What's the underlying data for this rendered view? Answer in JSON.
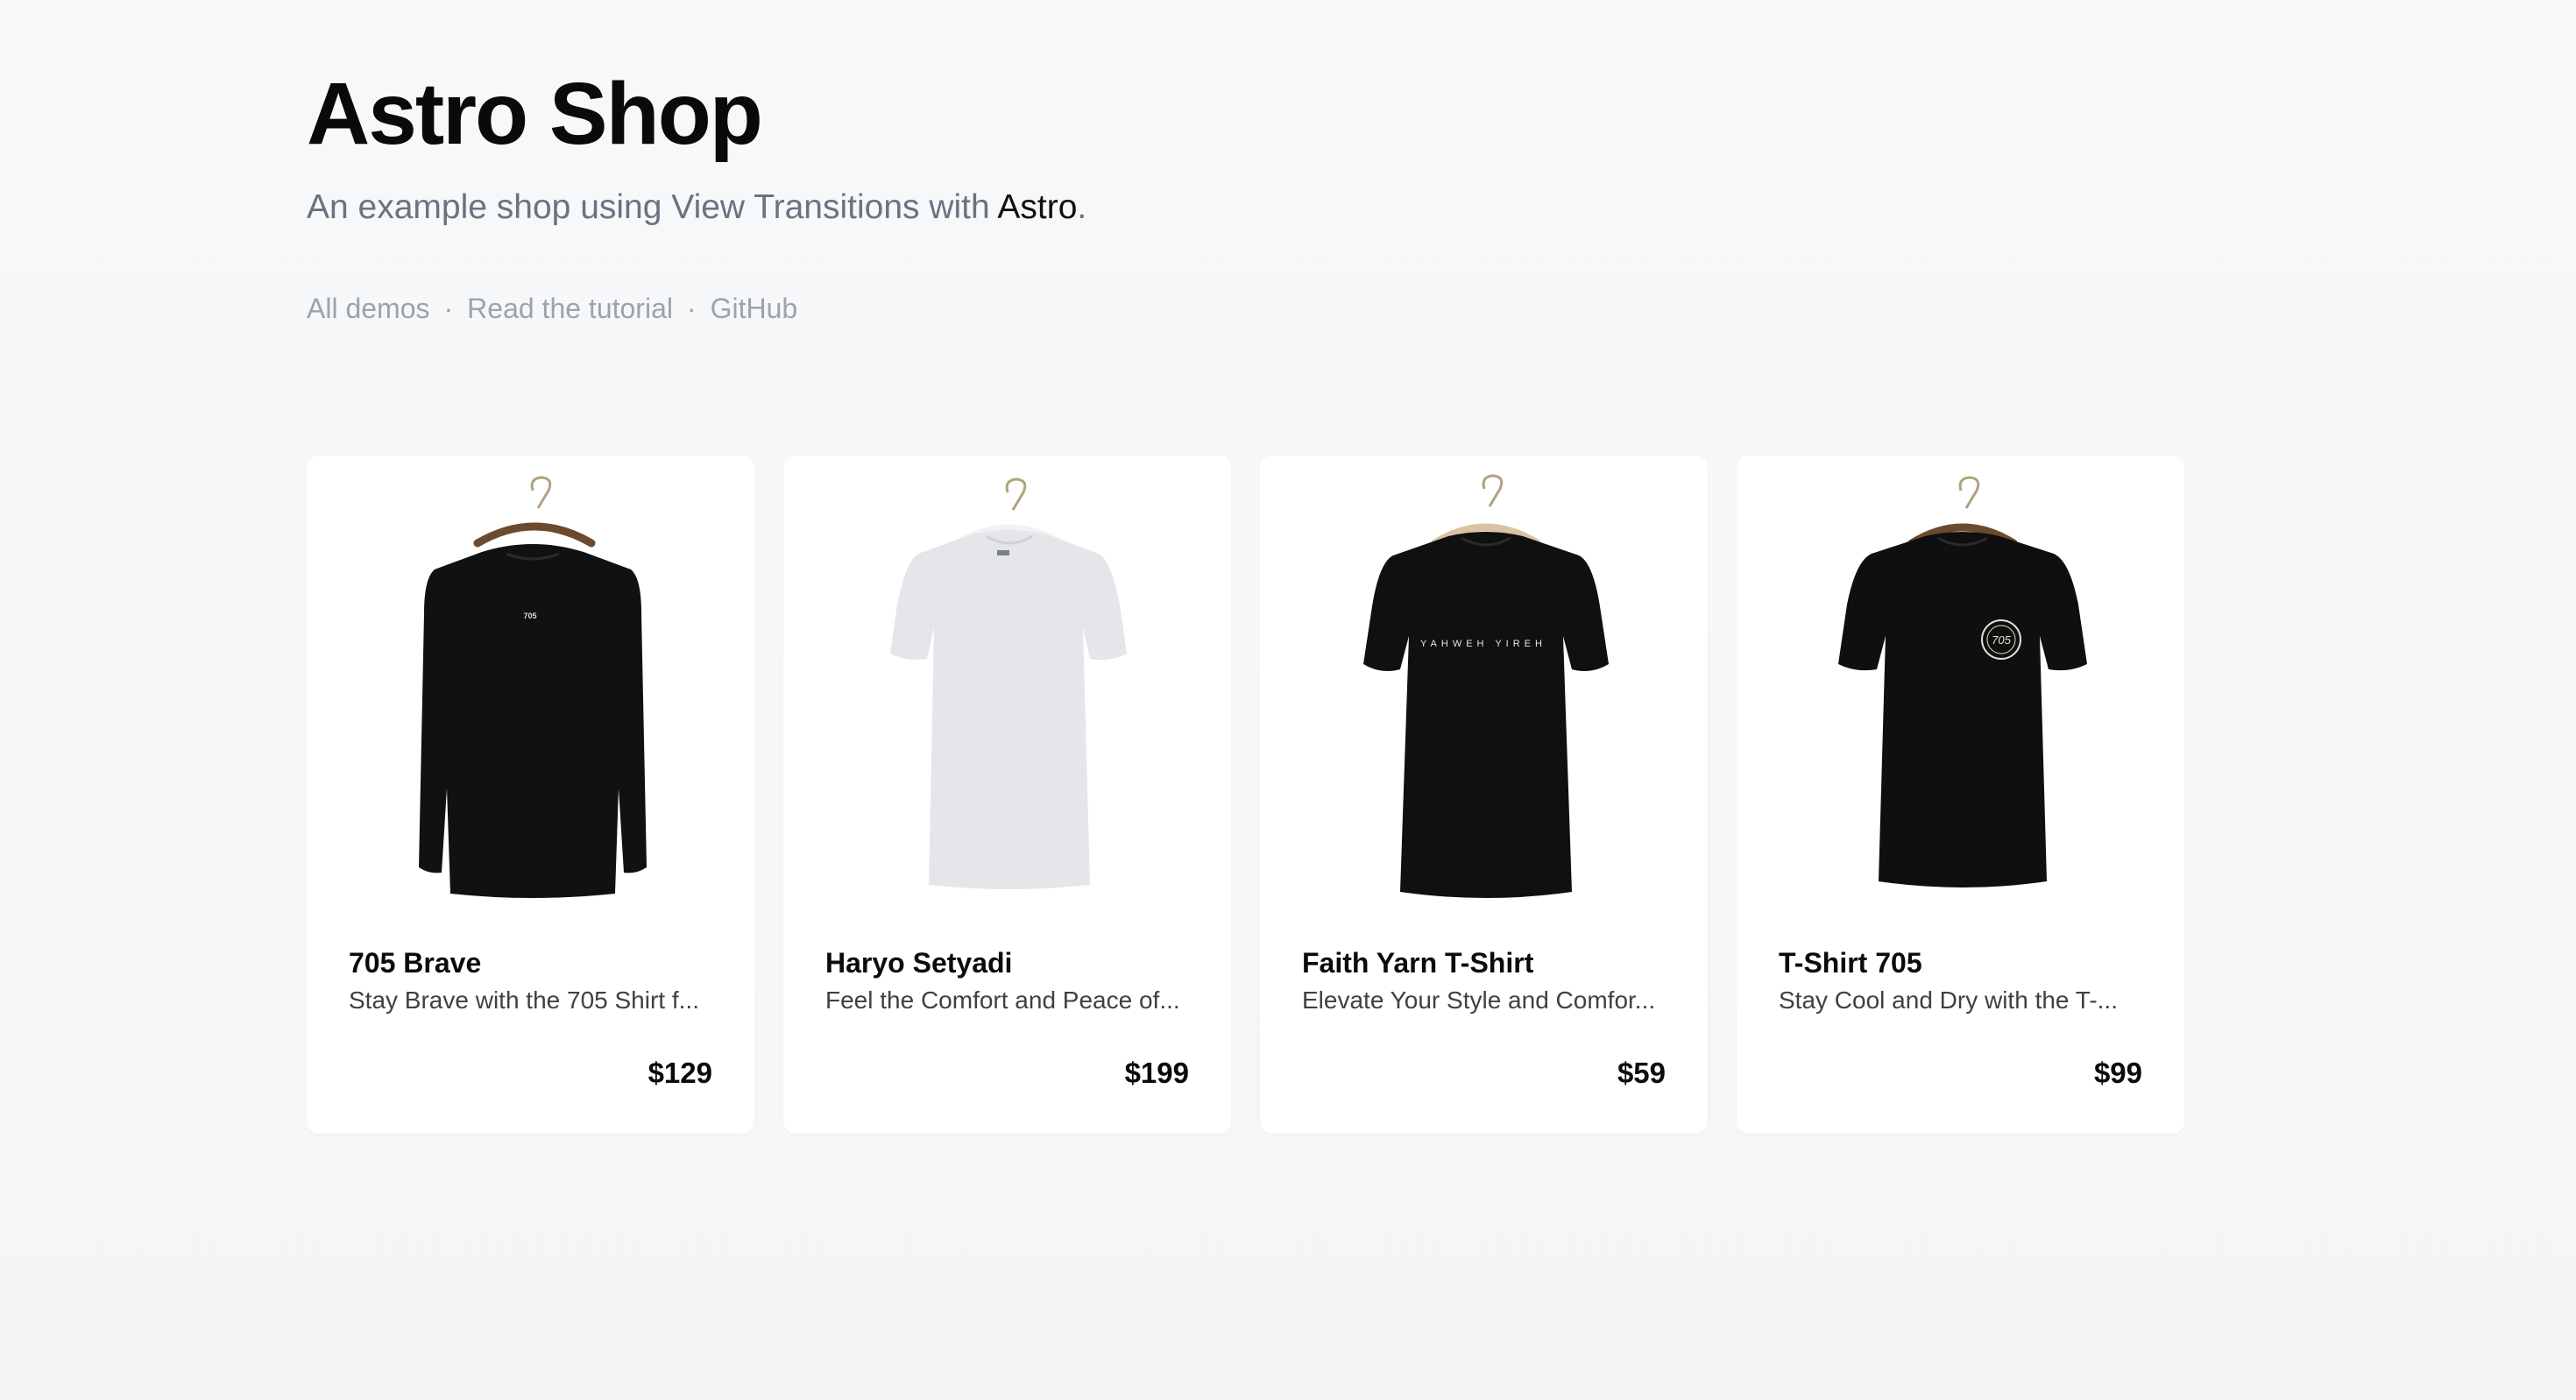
{
  "header": {
    "title": "Astro Shop",
    "subtitle_prefix": "An example shop using View Transitions with ",
    "subtitle_strong": "Astro",
    "subtitle_suffix": "."
  },
  "nav": {
    "links": [
      "All demos",
      "Read the tutorial",
      "GitHub"
    ],
    "separator": "·"
  },
  "products": [
    {
      "name": "705 Brave",
      "description": "Stay Brave with the 705 Shirt f...",
      "price": "$129",
      "image_icon": "black-longsleeve-shirt-icon",
      "shirt_color": "#111111",
      "print_text": "705"
    },
    {
      "name": "Haryo Setyadi",
      "description": "Feel the Comfort and Peace of...",
      "price": "$199",
      "image_icon": "white-tshirt-icon",
      "shirt_color": "#e4e6ea",
      "print_text": ""
    },
    {
      "name": "Faith Yarn T-Shirt",
      "description": "Elevate Your Style and Comfor...",
      "price": "$59",
      "image_icon": "black-tshirt-icon",
      "shirt_color": "#101010",
      "print_text": "YAHWEH YIREH"
    },
    {
      "name": "T-Shirt 705",
      "description": "Stay Cool and Dry with the T-...",
      "price": "$99",
      "image_icon": "black-tshirt-badge-icon",
      "shirt_color": "#0f0f0f",
      "print_text": "705"
    }
  ]
}
